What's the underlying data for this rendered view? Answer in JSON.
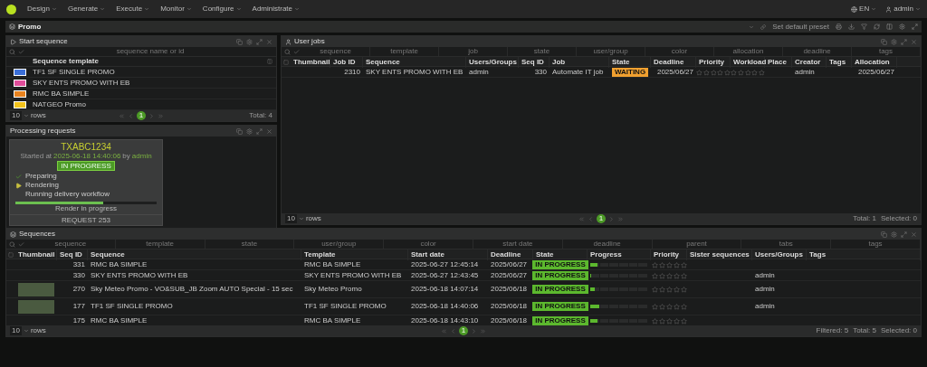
{
  "nav": {
    "menus": [
      "Design",
      "Generate",
      "Execute",
      "Monitor",
      "Configure",
      "Administrate"
    ],
    "language": "EN",
    "user": "admin"
  },
  "workspace": {
    "title": "Promo",
    "preset_button": "Set default preset"
  },
  "start_sequence": {
    "title": "Start sequence",
    "search_placeholder": "sequence name or id",
    "column": "Sequence template",
    "templates": [
      {
        "name": "TF1 SF SINGLE PROMO",
        "color": "#3b6fd8"
      },
      {
        "name": "SKY ENTS PROMO WITH EB",
        "color": "#e04d9a"
      },
      {
        "name": "RMC BA SIMPLE",
        "color": "#e8821e"
      },
      {
        "name": "NATGEO Promo",
        "color": "#f2c21b"
      }
    ],
    "footer": {
      "page_size": "10",
      "rows_label": "rows",
      "page": "1",
      "totals": [
        "Total: 4"
      ]
    }
  },
  "processing_requests": {
    "title": "Processing requests",
    "code": "TXABC1234",
    "started": [
      {
        "text": "Started at",
        "highlight": false
      },
      {
        "text": "2025-06-18 14:40:06",
        "highlight": true
      },
      {
        "text": "by",
        "highlight": false
      },
      {
        "text": "admin",
        "highlight": true
      }
    ],
    "status": "IN PROGRESS",
    "steps": [
      {
        "label": "Preparing",
        "kind": "done"
      },
      {
        "label": "Rendering",
        "kind": "active"
      },
      {
        "label": "Running delivery workflow",
        "kind": "pending"
      }
    ],
    "level": 0.62,
    "progress_label": "Render in progress",
    "request": "REQUEST 253"
  },
  "user_jobs": {
    "title": "User jobs",
    "filters": [
      {
        "placeholder": "sequence"
      },
      {
        "placeholder": "template"
      },
      {
        "placeholder": "job"
      },
      {
        "placeholder": "state"
      },
      {
        "placeholder": "user/group"
      },
      {
        "placeholder": "color"
      },
      {
        "placeholder": "allocation"
      },
      {
        "placeholder": "deadline"
      },
      {
        "placeholder": "tags"
      }
    ],
    "columns": [
      "Thumbnail",
      "Job ID",
      "Sequence",
      "Users/Groups",
      "Seq ID",
      "Job",
      "State",
      "Deadline",
      "Priority",
      "Workload",
      "Place",
      "Creator",
      "Tags",
      "Allocation"
    ],
    "rows": [
      {
        "tall": false,
        "cells": [
          {
            "kind": "blank"
          },
          {
            "kind": "number",
            "text": "2310"
          },
          {
            "kind": "text",
            "text": "SKY ENTS PROMO WITH EB"
          },
          {
            "kind": "text",
            "text": "admin"
          },
          {
            "kind": "number",
            "text": "330"
          },
          {
            "kind": "text",
            "text": "Automate IT job"
          },
          {
            "kind": "state",
            "text": "WAITING",
            "color": "#f0a030"
          },
          {
            "kind": "number",
            "text": "2025/06/27"
          },
          {
            "kind": "stars",
            "stars": 0
          },
          {
            "kind": "stars",
            "stars": 0
          },
          {
            "kind": "blank"
          },
          {
            "kind": "text",
            "text": "admin"
          },
          {
            "kind": "blank"
          },
          {
            "kind": "number",
            "text": "2025/06/27"
          }
        ]
      }
    ],
    "footer": {
      "page_size": "10",
      "rows_label": "rows",
      "page": "1",
      "totals": [
        "Total: 1",
        "Selected: 0"
      ]
    }
  },
  "sequences": {
    "title": "Sequences",
    "filters": [
      {
        "placeholder": "sequence"
      },
      {
        "placeholder": "template"
      },
      {
        "placeholder": "state"
      },
      {
        "placeholder": "user/group"
      },
      {
        "placeholder": "color"
      },
      {
        "placeholder": "start date"
      },
      {
        "placeholder": "deadline"
      },
      {
        "placeholder": "parent"
      },
      {
        "placeholder": "tabs"
      },
      {
        "placeholder": "tags"
      }
    ],
    "columns": [
      "Thumbnail",
      "Seq ID",
      "Sequence",
      "Template",
      "Start date",
      "Deadline",
      "State",
      "Progress",
      "Priority",
      "Sister sequences",
      "Users/Groups",
      "Tags"
    ],
    "rows": [
      {
        "tall": false,
        "cells": [
          {
            "kind": "thumbnail",
            "photo": false
          },
          {
            "kind": "number",
            "text": "331"
          },
          {
            "kind": "text",
            "text": "RMC BA SIMPLE"
          },
          {
            "kind": "text",
            "text": "RMC BA SIMPLE"
          },
          {
            "kind": "text",
            "text": "2025-06-27 12:45:14"
          },
          {
            "kind": "text",
            "text": "2025/06/27"
          },
          {
            "kind": "state",
            "text": "IN PROGRESS",
            "color": "#5cb82e"
          },
          {
            "kind": "progress",
            "level": 0.12
          },
          {
            "kind": "stars",
            "stars": 0
          },
          {
            "kind": "blank"
          },
          {
            "kind": "blank"
          },
          {
            "kind": "blank"
          }
        ]
      },
      {
        "tall": false,
        "cells": [
          {
            "kind": "thumbnail",
            "photo": false
          },
          {
            "kind": "number",
            "text": "330"
          },
          {
            "kind": "text",
            "text": "SKY ENTS PROMO WITH EB"
          },
          {
            "kind": "text",
            "text": "SKY ENTS PROMO WITH EB"
          },
          {
            "kind": "text",
            "text": "2025-06-27 12:43:45"
          },
          {
            "kind": "text",
            "text": "2025/06/27"
          },
          {
            "kind": "state",
            "text": "IN PROGRESS",
            "color": "#5cb82e"
          },
          {
            "kind": "progress",
            "level": 0
          },
          {
            "kind": "stars",
            "stars": 0
          },
          {
            "kind": "blank"
          },
          {
            "kind": "text",
            "text": "admin"
          },
          {
            "kind": "blank"
          }
        ]
      },
      {
        "tall": true,
        "cells": [
          {
            "kind": "thumbnail",
            "photo": true
          },
          {
            "kind": "number",
            "text": "270"
          },
          {
            "kind": "text",
            "text": "Sky Meteo Promo - VO&SUB_JB Zoom AUTO Special - 15 sec"
          },
          {
            "kind": "text",
            "text": "Sky Meteo Promo"
          },
          {
            "kind": "text",
            "text": "2025-06-18 14:07:14"
          },
          {
            "kind": "text",
            "text": "2025/06/18"
          },
          {
            "kind": "state",
            "text": "IN PROGRESS",
            "color": "#5cb82e"
          },
          {
            "kind": "progress",
            "level": 0.08
          },
          {
            "kind": "stars",
            "stars": 0
          },
          {
            "kind": "blank"
          },
          {
            "kind": "text",
            "text": "admin"
          },
          {
            "kind": "blank"
          }
        ]
      },
      {
        "tall": true,
        "cells": [
          {
            "kind": "thumbnail",
            "photo": true
          },
          {
            "kind": "number",
            "text": "177"
          },
          {
            "kind": "text",
            "text": "TF1 SF SINGLE PROMO"
          },
          {
            "kind": "text",
            "text": "TF1 SF SINGLE PROMO"
          },
          {
            "kind": "text",
            "text": "2025-06-18 14:40:06"
          },
          {
            "kind": "text",
            "text": "2025/06/18"
          },
          {
            "kind": "state",
            "text": "IN PROGRESS",
            "color": "#5cb82e"
          },
          {
            "kind": "progress",
            "level": 0.16
          },
          {
            "kind": "stars",
            "stars": 0
          },
          {
            "kind": "blank"
          },
          {
            "kind": "text",
            "text": "admin"
          },
          {
            "kind": "blank"
          }
        ]
      },
      {
        "tall": false,
        "cells": [
          {
            "kind": "thumbnail",
            "photo": false
          },
          {
            "kind": "number",
            "text": "175"
          },
          {
            "kind": "text",
            "text": "RMC BA SIMPLE"
          },
          {
            "kind": "text",
            "text": "RMC BA SIMPLE"
          },
          {
            "kind": "text",
            "text": "2025-06-18 14:43:10"
          },
          {
            "kind": "text",
            "text": "2025/06/18"
          },
          {
            "kind": "state",
            "text": "IN PROGRESS",
            "color": "#5cb82e"
          },
          {
            "kind": "progress",
            "level": 0.12
          },
          {
            "kind": "stars",
            "stars": 0
          },
          {
            "kind": "blank"
          },
          {
            "kind": "blank"
          },
          {
            "kind": "blank"
          }
        ]
      }
    ],
    "footer": {
      "page_size": "10",
      "rows_label": "rows",
      "page": "1",
      "totals": [
        "Filtered: 5",
        "Total: 5",
        "Selected: 0"
      ]
    }
  }
}
